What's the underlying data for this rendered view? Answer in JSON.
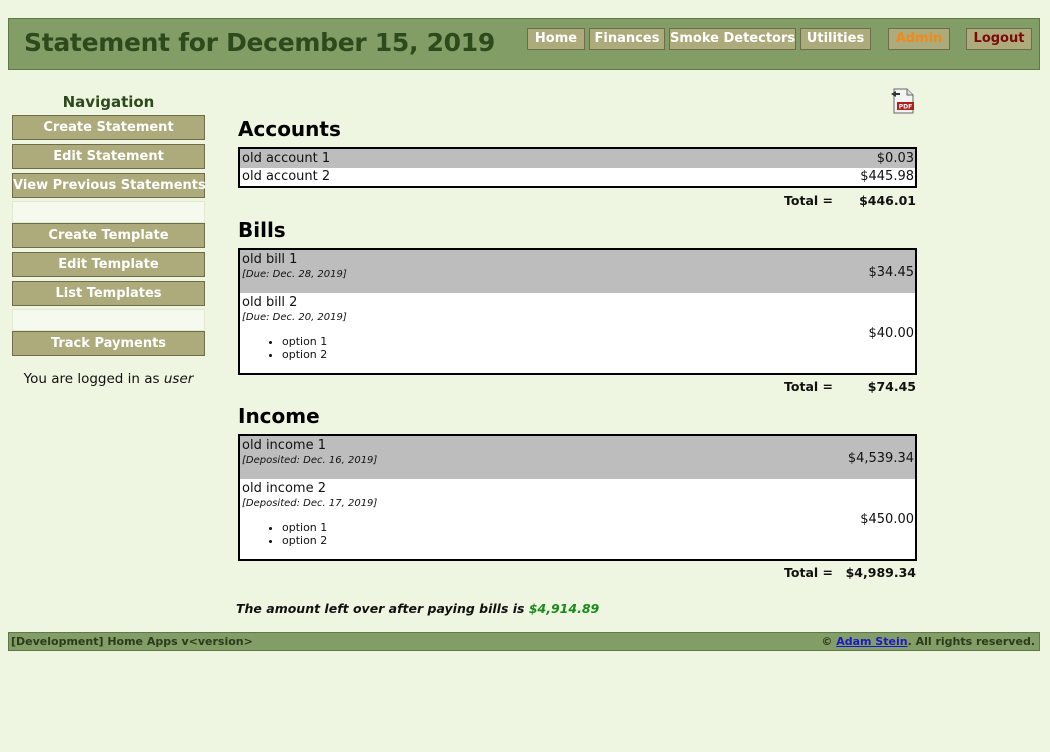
{
  "header": {
    "title": "Statement for December 15, 2019",
    "nav": {
      "home": "Home",
      "finances": "Finances",
      "smoke_detectors": "Smoke Detectors",
      "utilities": "Utilities",
      "admin": "Admin",
      "logout": "Logout"
    },
    "colors": {
      "admin": "#f08a1c",
      "logout": "#7a0a0a"
    }
  },
  "sidebar": {
    "heading": "Navigation",
    "items": [
      {
        "label": "Create Statement"
      },
      {
        "label": "Edit Statement"
      },
      {
        "label": "View Previous Statements"
      },
      {
        "label": "Create Template"
      },
      {
        "label": "Edit Template"
      },
      {
        "label": "List Templates"
      },
      {
        "label": "Track Payments"
      }
    ],
    "logged_in_prefix": "You are logged in as ",
    "username": "user"
  },
  "main": {
    "pdf_icon": "pdf-file-icon",
    "accounts": {
      "title": "Accounts",
      "rows": [
        {
          "name": "old account 1",
          "amount": "$0.03"
        },
        {
          "name": "old account 2",
          "amount": "$445.98"
        }
      ],
      "total_label": "Total =",
      "total_value": "$446.01"
    },
    "bills": {
      "title": "Bills",
      "rows": [
        {
          "name": "old bill 1",
          "note": "[Due: Dec. 28, 2019]",
          "amount": "$34.45"
        },
        {
          "name": "old bill 2",
          "note": "[Due: Dec. 20, 2019]",
          "amount": "$40.00",
          "options": [
            "option 1",
            "option 2"
          ]
        }
      ],
      "total_label": "Total =",
      "total_value": "$74.45"
    },
    "income": {
      "title": "Income",
      "rows": [
        {
          "name": "old income 1",
          "note": "[Deposited: Dec. 16, 2019]",
          "amount": "$4,539.34"
        },
        {
          "name": "old income 2",
          "note": "[Deposited: Dec. 17, 2019]",
          "amount": "$450.00",
          "options": [
            "option 1",
            "option 2"
          ]
        }
      ],
      "total_label": "Total =",
      "total_value": "$4,989.34"
    },
    "leftover_text": "The amount left over after paying bills is ",
    "leftover_amount": "$4,914.89"
  },
  "footer": {
    "left": "[Development] Home Apps v<version>",
    "copyright": "© ",
    "author": "Adam Stein",
    "rights": ". All rights reserved."
  }
}
